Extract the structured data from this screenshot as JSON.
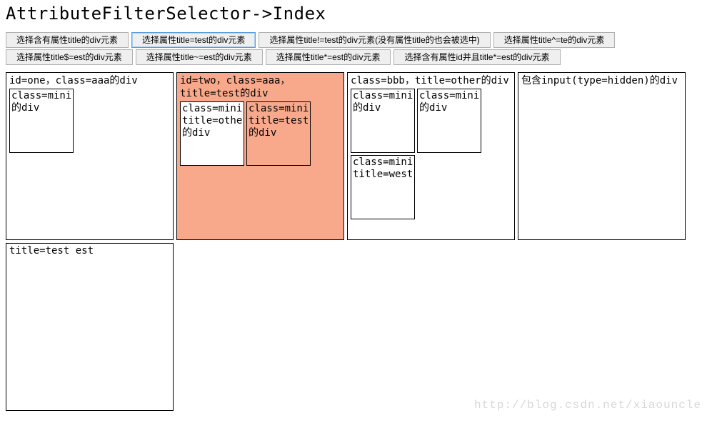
{
  "heading": "AttributeFilterSelector->Index",
  "buttons_row1": [
    {
      "label": "选择含有属性title的div元素",
      "active": false
    },
    {
      "label": "选择属性title=test的div元素",
      "active": true
    },
    {
      "label": "选择属性title!=test的div元素(没有属性title的也会被选中)",
      "active": false
    },
    {
      "label": "选择属性title^=te的div元素",
      "active": false
    }
  ],
  "buttons_row2": [
    {
      "label": "选择属性title$=est的div元素",
      "active": false
    },
    {
      "label": "选择属性title~=est的div元素",
      "active": false
    },
    {
      "label": "选择属性title*=est的div元素",
      "active": false
    },
    {
      "label": "选择含有属性id并且title*=est的div元素",
      "active": false
    }
  ],
  "boxes": [
    {
      "label": "id=one，class=aaa的div",
      "highlighted": false,
      "children": [
        {
          "label": "class=mini的div"
        }
      ]
    },
    {
      "label": "id=two，class=aaa，title=test的div",
      "highlighted": true,
      "children": [
        {
          "label": "class=mini，title=other的div"
        },
        {
          "label": "class=mini，title=test的div"
        }
      ]
    },
    {
      "label": "class=bbb，title=other的div",
      "highlighted": false,
      "children": [
        {
          "label": "class=mini的div"
        },
        {
          "label": "class=mini的div"
        },
        {
          "label": "class=mini，title=west"
        }
      ]
    },
    {
      "label": "包含input(type=hidden)的div",
      "highlighted": false,
      "children": []
    }
  ],
  "last_box": {
    "label": "title=test est"
  },
  "watermark": "http://blog.csdn.net/xiaouncle"
}
